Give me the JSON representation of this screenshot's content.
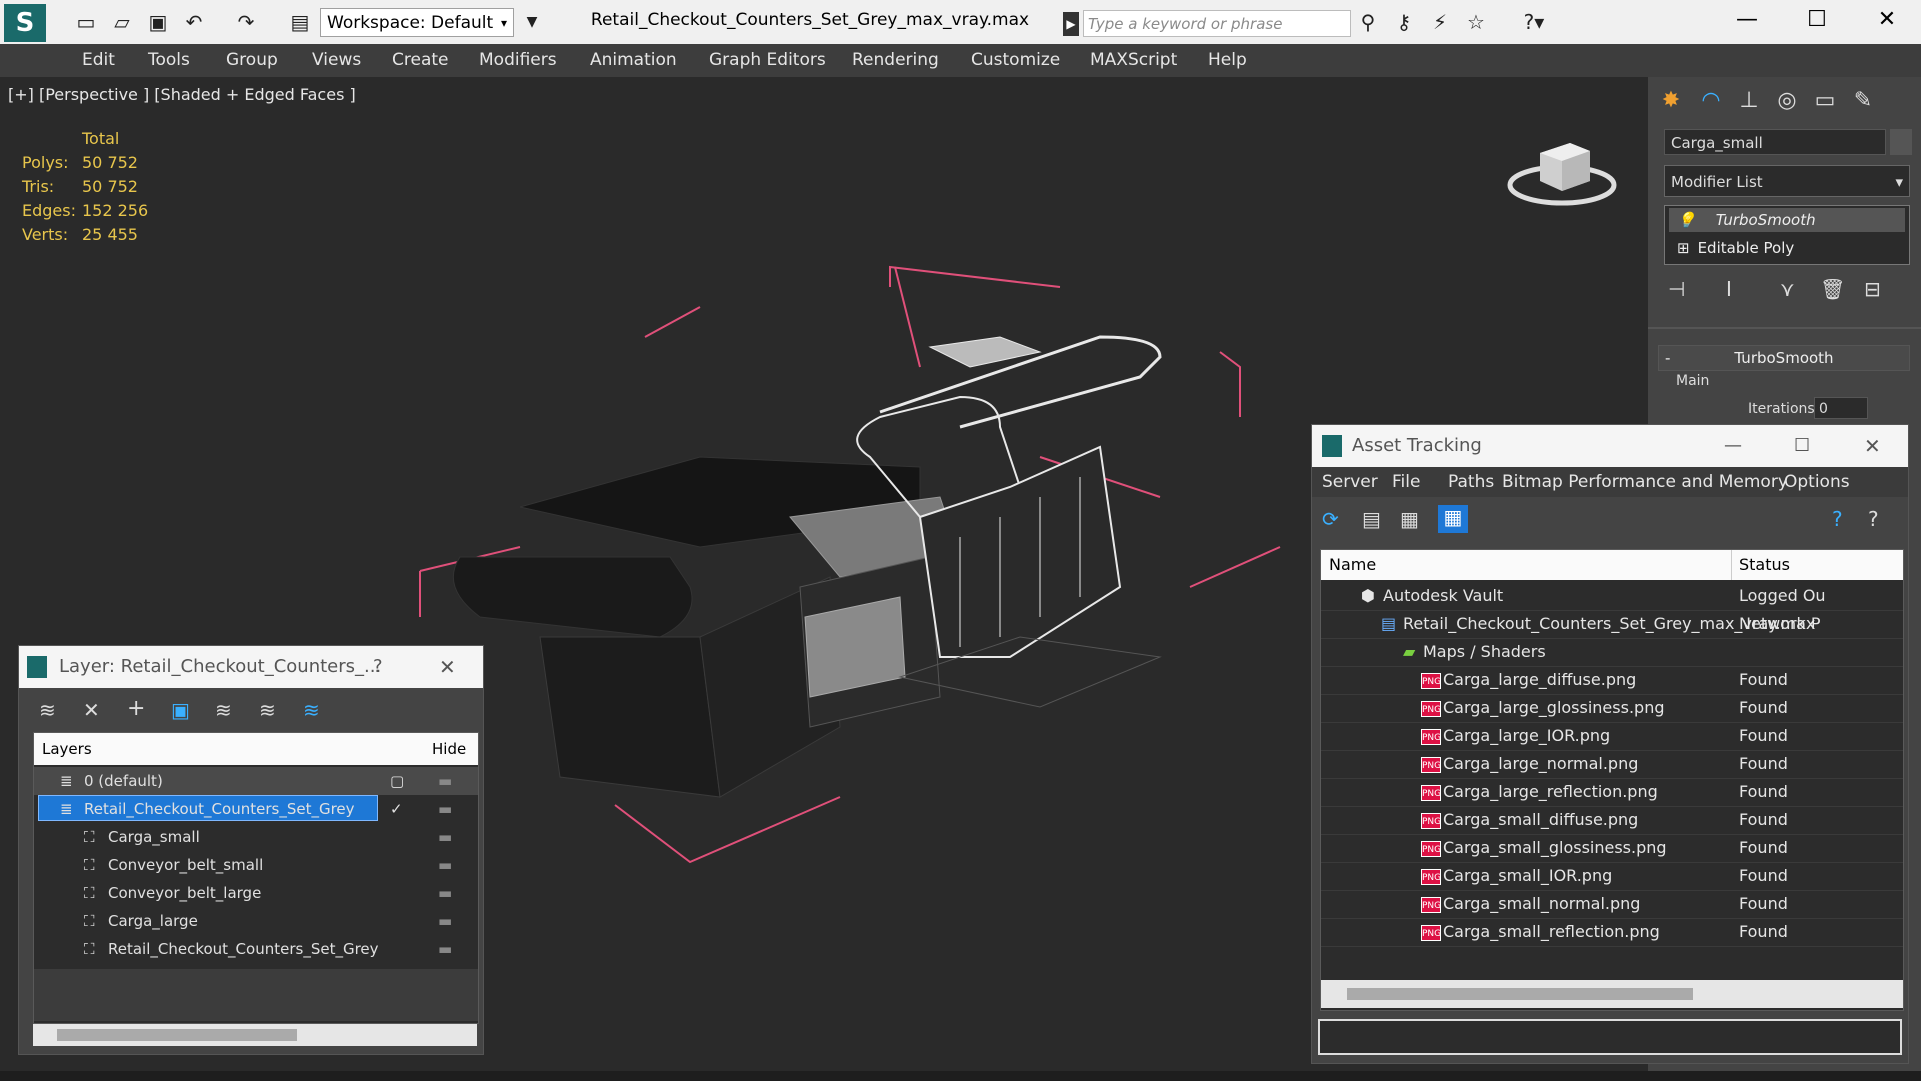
{
  "titlebar": {
    "workspace": "Workspace: Default",
    "file_title": "Retail_Checkout_Counters_Set_Grey_max_vray.max",
    "search_placeholder": "Type a keyword or phrase"
  },
  "menu": [
    "Edit",
    "Tools",
    "Group",
    "Views",
    "Create",
    "Modifiers",
    "Animation",
    "Graph Editors",
    "Rendering",
    "Customize",
    "MAXScript",
    "Help"
  ],
  "viewport": {
    "label": "[+] [Perspective ] [Shaded + Edged Faces ]",
    "stats_header": "Total",
    "stats": [
      {
        "label": "Polys:",
        "value": "50 752"
      },
      {
        "label": "Tris:",
        "value": "50 752"
      },
      {
        "label": "Edges:",
        "value": "152 256"
      },
      {
        "label": "Verts:",
        "value": "25 455"
      }
    ]
  },
  "command_panel": {
    "object_name": "Carga_small",
    "modifier_list": "Modifier List",
    "stack": [
      "TurboSmooth",
      "Editable Poly"
    ],
    "rollout_title": "TurboSmooth",
    "group_main": "Main",
    "iterations_label": "Iterations:",
    "iterations_value": "0"
  },
  "layer_dialog": {
    "title": "Layer: Retail_Checkout_Counters_...",
    "help": "?",
    "col_layers": "Layers",
    "col_hide": "Hide",
    "rows": [
      {
        "name": "0 (default)"
      },
      {
        "name": "Retail_Checkout_Counters_Set_Grey"
      },
      {
        "name": "Carga_small"
      },
      {
        "name": "Conveyor_belt_small"
      },
      {
        "name": "Conveyor_belt_large"
      },
      {
        "name": "Carga_large"
      },
      {
        "name": "Retail_Checkout_Counters_Set_Grey"
      }
    ]
  },
  "asset_dialog": {
    "title": "Asset Tracking",
    "menu": [
      "Server",
      "File",
      "Paths",
      "Bitmap Performance and Memory",
      "Options"
    ],
    "col_name": "Name",
    "col_status": "Status",
    "rows": [
      {
        "name": "Autodesk Vault",
        "status": "Logged Ou"
      },
      {
        "name": "Retail_Checkout_Counters_Set_Grey_max_vray.max",
        "status": "Network P"
      },
      {
        "name": "Maps / Shaders",
        "status": ""
      },
      {
        "name": "Carga_large_diffuse.png",
        "status": "Found"
      },
      {
        "name": "Carga_large_glossiness.png",
        "status": "Found"
      },
      {
        "name": "Carga_large_IOR.png",
        "status": "Found"
      },
      {
        "name": "Carga_large_normal.png",
        "status": "Found"
      },
      {
        "name": "Carga_large_reflection.png",
        "status": "Found"
      },
      {
        "name": "Carga_small_diffuse.png",
        "status": "Found"
      },
      {
        "name": "Carga_small_glossiness.png",
        "status": "Found"
      },
      {
        "name": "Carga_small_IOR.png",
        "status": "Found"
      },
      {
        "name": "Carga_small_normal.png",
        "status": "Found"
      },
      {
        "name": "Carga_small_reflection.png",
        "status": "Found"
      }
    ]
  },
  "colors": {
    "accent": "#1e78d6",
    "stats": "#e8c64c",
    "bbox": "#e0507a"
  }
}
